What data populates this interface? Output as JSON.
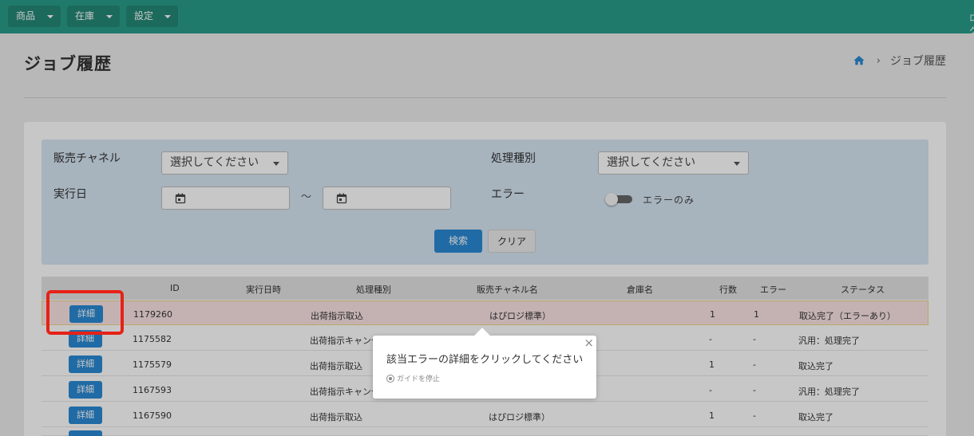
{
  "nav": {
    "menus": [
      {
        "label": "商品"
      },
      {
        "label": "在庫"
      },
      {
        "label": "設定"
      }
    ],
    "right_edge_text": "ログ"
  },
  "header": {
    "title": "ジョブ履歴",
    "breadcrumb": {
      "separator": "›",
      "current": "ジョブ履歴"
    }
  },
  "search": {
    "channel_label": "販売チャネル",
    "channel_value": "選択してください",
    "process_label": "処理種別",
    "process_value": "選択してください",
    "date_label": "実行日",
    "date_separator": "～",
    "error_label": "エラー",
    "error_toggle_label": "エラーのみ",
    "error_toggle_on": false,
    "search_button": "検索",
    "clear_button": "クリア"
  },
  "table": {
    "headers": {
      "id": "ID",
      "executed_at": "実行日時",
      "process_type": "処理種別",
      "channel": "販売チャネル名",
      "warehouse": "倉庫名",
      "lines": "行数",
      "errors": "エラー",
      "status": "ステータス"
    },
    "detail_label": "詳細",
    "rows": [
      {
        "id": "1179260",
        "executed_at": "",
        "process_type": "出荷指示取込",
        "channel": "はぴロジ標準）",
        "warehouse": "",
        "lines": "1",
        "errors": "1",
        "status": "取込完了（エラーあり）"
      },
      {
        "id": "1175582",
        "executed_at": "",
        "process_type": "出荷指示キャンセ",
        "channel": "",
        "warehouse": "",
        "lines": "-",
        "errors": "-",
        "status": "汎用：処理完了"
      },
      {
        "id": "1175579",
        "executed_at": "",
        "process_type": "出荷指示取込",
        "channel": "",
        "warehouse": "",
        "lines": "1",
        "errors": "-",
        "status": "取込完了"
      },
      {
        "id": "1167593",
        "executed_at": "",
        "process_type": "出荷指示キャンセ",
        "channel": "",
        "warehouse": "",
        "lines": "-",
        "errors": "-",
        "status": "汎用：処理完了"
      },
      {
        "id": "1167590",
        "executed_at": "",
        "process_type": "出荷指示取込",
        "channel": "はぴロジ標準）",
        "warehouse": "",
        "lines": "1",
        "errors": "-",
        "status": "取込完了"
      }
    ]
  },
  "guide": {
    "message": "該当エラーの詳細をクリックしてください",
    "stop_label": "ガイドを停止",
    "close_symbol": "×"
  },
  "colors": {
    "navbar": "#2a9d8a",
    "primary_button": "#2a8ad4",
    "highlight_ring": "#e62117",
    "highlight_row": "#fbe4e4"
  }
}
